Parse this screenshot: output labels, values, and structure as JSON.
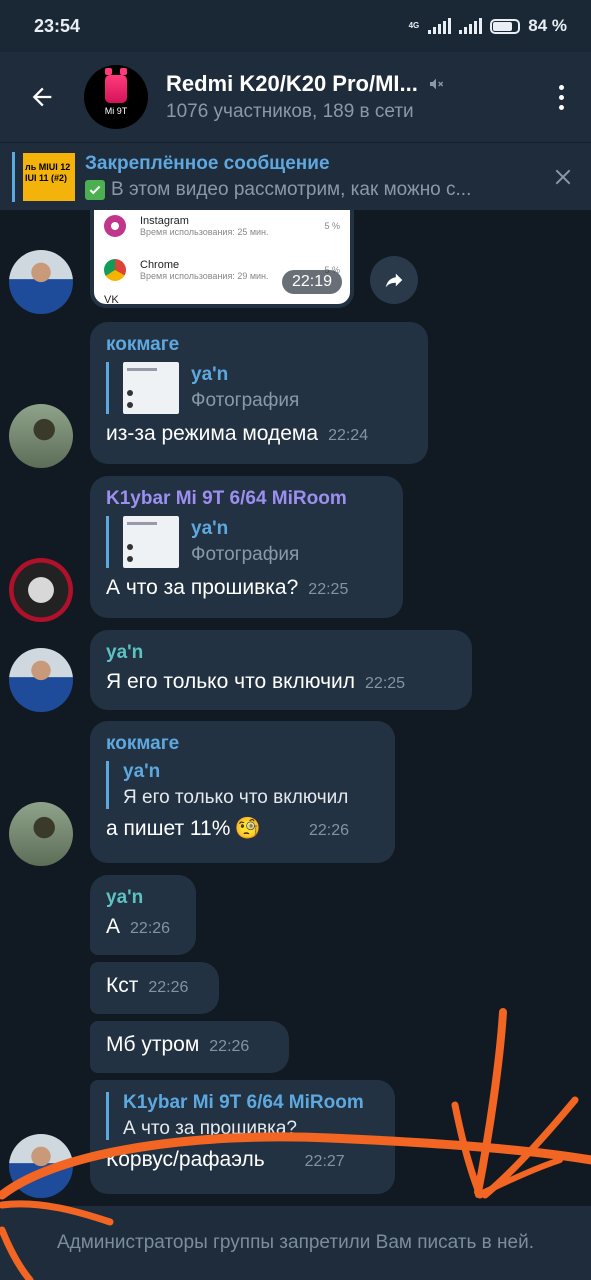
{
  "status_bar": {
    "time": "23:54",
    "network": "4G",
    "battery": "84 %"
  },
  "header": {
    "title": "Redmi K20/K20 Pro/MI...",
    "subtitle": "1076 участников, 189 в сети",
    "avatar_label": "Mi 9T"
  },
  "pinned": {
    "title": "Закреплённое сообщение",
    "text": "В этом видео рассмотрим, как можно с...",
    "thumb_text": "ль MIUI 12 IUI 11 (#2)"
  },
  "image_message": {
    "apps": [
      {
        "name": "Instagram",
        "usage": "Время использования: 25 мин.",
        "percent": "5 %"
      },
      {
        "name": "Chrome",
        "usage": "Время использования: 29 мин.",
        "percent": "5 %"
      },
      {
        "name": "VK",
        "usage": "",
        "percent": ""
      }
    ],
    "time": "22:19"
  },
  "messages": [
    {
      "sender": "кокмаге",
      "reply_name": "ya'n",
      "reply_text": "Фотография",
      "text": "из-за режима модема",
      "time": "22:24"
    },
    {
      "sender": "K1ybar Mi 9T 6/64 MiRoom",
      "reply_name": "ya'n",
      "reply_text": "Фотография",
      "text": "А что за прошивка?",
      "time": "22:25"
    },
    {
      "sender": "ya'n",
      "text": "Я его только что включил",
      "time": "22:25"
    },
    {
      "sender": "кокмаге",
      "reply_name": "ya'n",
      "reply_text": "Я его только что включил",
      "text": "а пишет 11%",
      "emoji": "🧐",
      "time": "22:26"
    },
    {
      "sender": "ya'n",
      "text": "А",
      "time": "22:26"
    },
    {
      "text": "Кст",
      "time": "22:26"
    },
    {
      "text": "Мб утром",
      "time": "22:26"
    },
    {
      "reply_name": "K1ybar Mi 9T 6/64 MiRoom",
      "reply_text": "А что за прошивка?",
      "text": "Корвус/рафаэль",
      "time": "22:27"
    }
  ],
  "bottom_notice": "Администраторы группы запретили Вам писать в ней.",
  "colors": {
    "accent": "#5ea8e0",
    "background": "#111a22",
    "bubble": "#223242",
    "annotation": "#f26522"
  }
}
